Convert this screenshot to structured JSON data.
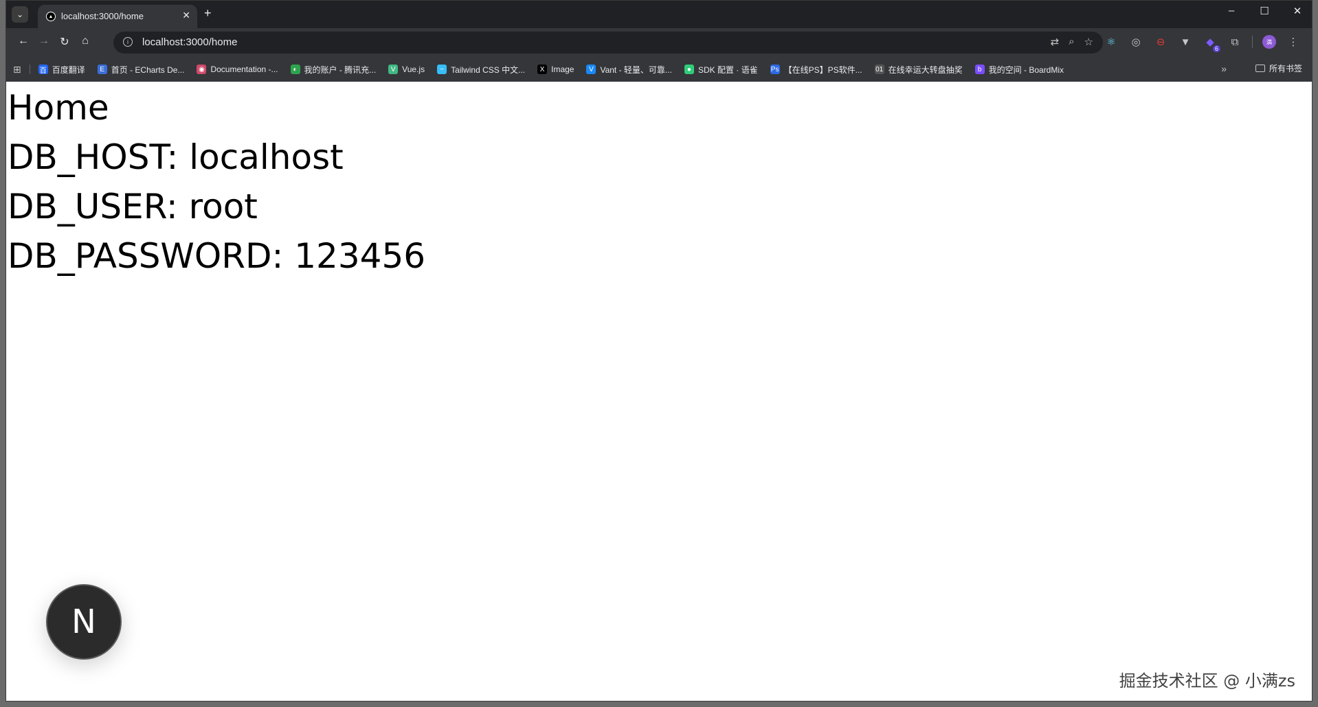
{
  "tab": {
    "title": "localhost:3000/home",
    "favicon": "nextjs-icon"
  },
  "window_controls": {
    "minimize": "–",
    "maximize": "☐",
    "close": "✕"
  },
  "address_bar": {
    "url": "localhost:3000/home"
  },
  "bookmarks": [
    {
      "label": "百度翻译",
      "icon_color": "#2468f2",
      "icon": "百"
    },
    {
      "label": "首页 - ECharts De...",
      "icon_color": "#3b6fd9",
      "icon": "E"
    },
    {
      "label": "Documentation -...",
      "icon_color": "#d04a6a",
      "icon": "◉"
    },
    {
      "label": "我的账户 - 腾讯充...",
      "icon_color": "#2ea44f",
      "icon": "◐"
    },
    {
      "label": "Vue.js",
      "icon_color": "#41b883",
      "icon": "V"
    },
    {
      "label": "Tailwind CSS 中文...",
      "icon_color": "#38bdf8",
      "icon": "~"
    },
    {
      "label": "Image",
      "icon_color": "#000000",
      "icon": "X"
    },
    {
      "label": "Vant - 轻量、可靠...",
      "icon_color": "#1989fa",
      "icon": "V"
    },
    {
      "label": "SDK 配置 · 语雀",
      "icon_color": "#31cc79",
      "icon": "●"
    },
    {
      "label": "【在线PS】PS软件...",
      "icon_color": "#2d6ae3",
      "icon": "Ps"
    },
    {
      "label": "在线幸运大转盘抽奖",
      "icon_color": "#555555",
      "icon": "01"
    },
    {
      "label": "我的空间 - BoardMix",
      "icon_color": "#7a4dff",
      "icon": "b"
    }
  ],
  "all_bookmarks_label": "所有书签",
  "page": {
    "heading": "Home",
    "db_host": "DB_HOST: localhost",
    "db_user": "DB_USER: root",
    "db_password": "DB_PASSWORD: 123456"
  },
  "next_badge_letter": "N",
  "watermark": "掘金技术社区 @ 小满zs",
  "extension_badge_count": "6"
}
